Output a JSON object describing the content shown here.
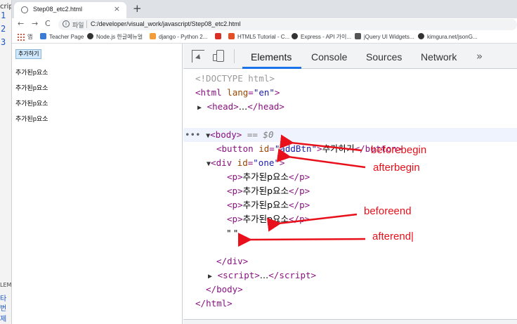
{
  "left_strip": {
    "script_fragment": "cript",
    "line_numbers": [
      "1",
      "2",
      "3"
    ],
    "elems_fragment": "LEMS",
    "korean_fragment_1": "타",
    "korean_fragment_2": "번 제"
  },
  "browser": {
    "tab_title": "Step08_etc2.html",
    "tab_close": "×",
    "new_tab": "+",
    "nav": {
      "back": "←",
      "forward": "→",
      "reload": "C"
    },
    "address": {
      "scheme_label": "파일",
      "url": "C:/developer/visual_work/javascript/Step08_etc2.html"
    },
    "bookmarks": [
      {
        "label": "앱",
        "color": "#e0553b"
      },
      {
        "label": "Teacher Page",
        "color": "#3a7bd5"
      },
      {
        "label": "Node.js 한글메뉴얼",
        "color": "#333333"
      },
      {
        "label": "django - Python 2...",
        "color": "#f29d38"
      },
      {
        "label": "",
        "color": "#d93025"
      },
      {
        "label": "HTML5 Tutorial - C...",
        "color": "#e44d26"
      },
      {
        "label": "Express - API 가이...",
        "color": "#333333"
      },
      {
        "label": "jQuery UI Widgets...",
        "color": "#555555"
      },
      {
        "label": "kimgura.net/jsonG...",
        "color": "#333333"
      }
    ]
  },
  "page": {
    "button_label": "추가하기",
    "paragraphs": [
      "추가된p요소",
      "추가된p요소",
      "추가된p요소",
      "추가된p요소"
    ]
  },
  "devtools": {
    "tabs": [
      "Elements",
      "Console",
      "Sources",
      "Network"
    ],
    "active_tab": "Elements",
    "more": "»",
    "dom": {
      "doctype": "<!DOCTYPE html>",
      "html_open_tag": "html",
      "html_lang_attr": "lang",
      "html_lang_val": "\"en\"",
      "head_tag": "head",
      "head_ellipsis": "…",
      "body_tag": "body",
      "body_eq": "== $0",
      "button_tag": "button",
      "button_id_attr": "id",
      "button_id_val": "\"addBtn\"",
      "button_text": "추가하기",
      "div_tag": "div",
      "div_id_attr": "id",
      "div_id_val": "\"one\"",
      "p_tag": "p",
      "p_text": "추가된p요소",
      "whitespace_text": "\" \"",
      "script_tag": "script",
      "script_ellipsis": "…",
      "row_dots": "•••"
    }
  },
  "annotations": {
    "labels": [
      "beforebegin",
      "afterbegin",
      "beforeend",
      "afterend|"
    ],
    "color": "#e8101a"
  }
}
